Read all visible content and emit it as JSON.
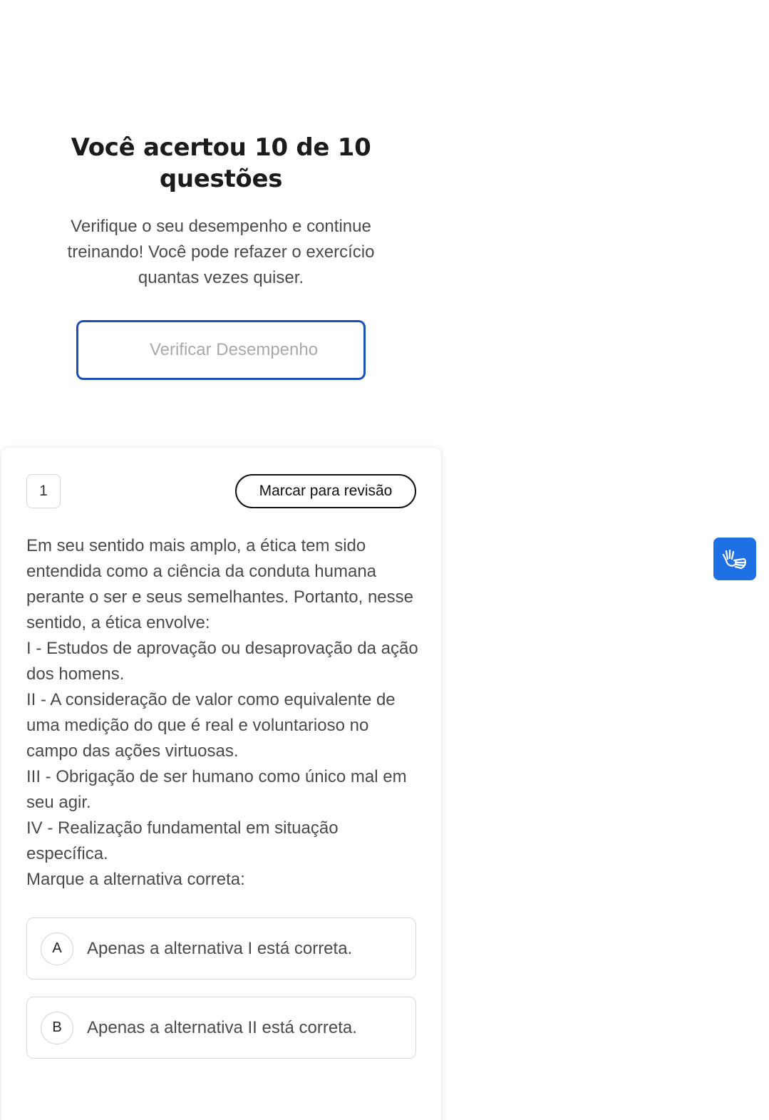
{
  "result": {
    "title": "Você acertou 10 de 10 questões",
    "subtitle": "Verifique o seu desempenho e continue treinando! Você pode refazer o exercício quantas vezes quiser.",
    "verify_button_label": "Verificar Desempenho"
  },
  "question": {
    "number": "1",
    "review_button_label": "Marcar para revisão",
    "statement_lines": [
      "Em seu sentido mais amplo, a ética tem sido entendida como a ciência da conduta humana perante o ser e seus semelhantes. Portanto, nesse sentido, a ética envolve:",
      "I - Estudos de aprovação ou desaprovação da ação dos homens.",
      "II - A consideração de valor como equivalente de uma medição do que é real e voluntarioso no campo das ações virtuosas.",
      "III - Obrigação de ser humano como único mal em seu agir.",
      "IV - Realização fundamental em situação específica.",
      "Marque a alternativa correta:"
    ],
    "options": [
      {
        "letter": "A",
        "text": "Apenas a alternativa I está correta."
      },
      {
        "letter": "B",
        "text": "Apenas a alternativa II está correta."
      }
    ]
  },
  "accessibility_widget": {
    "icon": "sign-language-hands-icon",
    "color": "#1f6fe5"
  },
  "colors": {
    "accent_border": "#1d4fba",
    "text": "#4a4a4a",
    "title": "#1b1b1b"
  }
}
